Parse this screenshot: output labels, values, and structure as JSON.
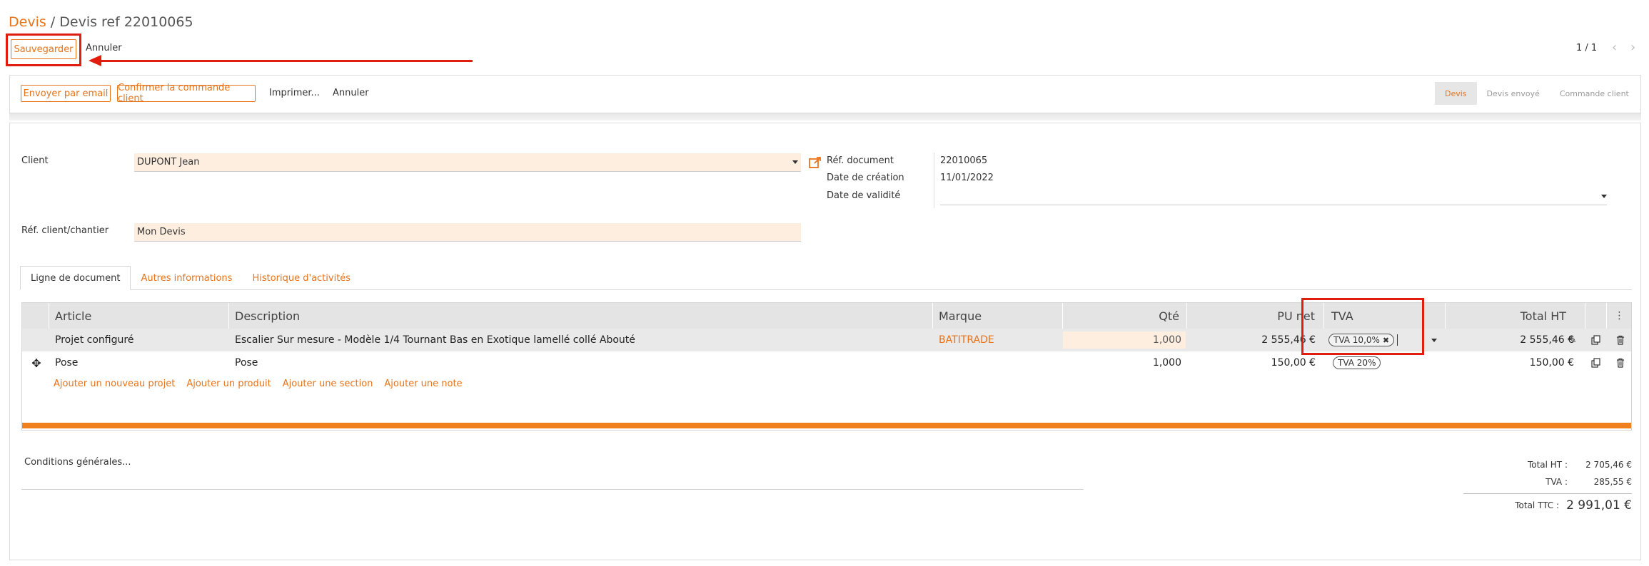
{
  "breadcrumb": {
    "root": "Devis",
    "separator": "/",
    "current": "Devis ref 22010065"
  },
  "toolbar": {
    "save_label": "Sauvegarder",
    "cancel_label": "Annuler",
    "pager": "1 / 1"
  },
  "actions": {
    "email_label": "Envoyer par email",
    "confirm_label": "Confirmer la commande client",
    "print_label": "Imprimer...",
    "cancel_label": "Annuler"
  },
  "status_steps": [
    "Devis",
    "Devis envoyé",
    "Commande client"
  ],
  "form": {
    "client_label": "Client",
    "client_value": "DUPONT Jean",
    "ref_client_label": "Réf. client/chantier",
    "ref_client_value": "Mon Devis",
    "ref_doc_label": "Réf. document",
    "ref_doc_value": "22010065",
    "date_creation_label": "Date de création",
    "date_creation_value": "11/01/2022",
    "date_validite_label": "Date de validité",
    "date_validite_value": ""
  },
  "tabs": [
    "Ligne de document",
    "Autres informations",
    "Historique d'activités"
  ],
  "table": {
    "headers": {
      "article": "Article",
      "description": "Description",
      "marque": "Marque",
      "qte": "Qté",
      "pu_net": "PU net",
      "tva": "TVA",
      "total_ht": "Total HT"
    },
    "rows": [
      {
        "article": "Projet configuré",
        "description": "Escalier Sur mesure - Modèle 1/4 Tournant Bas en Exotique lamellé collé Abouté",
        "marque": "BATITRADE",
        "qte": "1,000",
        "pu_net": "2 555,46 €",
        "tva": "TVA 10,0%",
        "total_ht": "2 555,46 €"
      },
      {
        "article": "Pose",
        "description": "Pose",
        "marque": "",
        "qte": "1,000",
        "pu_net": "150,00 €",
        "tva": "TVA 20%",
        "total_ht": "150,00 €"
      }
    ],
    "add_links": [
      "Ajouter un nouveau projet",
      "Ajouter un produit",
      "Ajouter une section",
      "Ajouter une note"
    ]
  },
  "footer": {
    "conditions_label": "Conditions générales...",
    "total_ht_label": "Total HT :",
    "total_ht_value": "2 705,46 €",
    "tva_label": "TVA :",
    "tva_value": "285,55 €",
    "total_ttc_label": "Total TTC :",
    "total_ttc_value": "2 991,01 €"
  },
  "colors": {
    "accent": "#e8731a",
    "annotation": "#e11d0f",
    "field_bg": "#fdeee0"
  }
}
